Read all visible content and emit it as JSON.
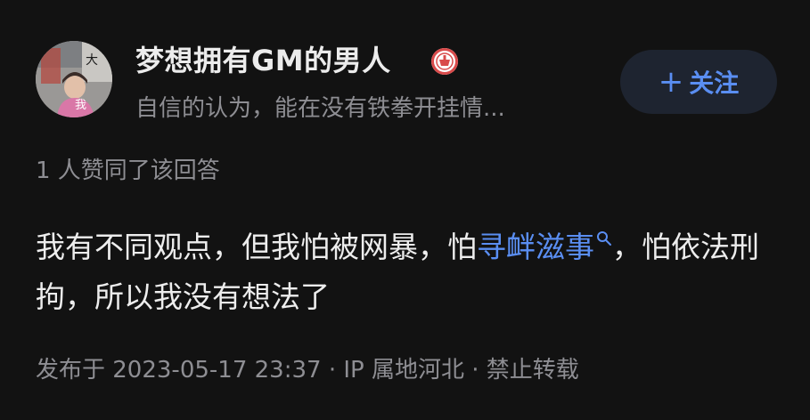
{
  "author": {
    "name": "梦想拥有GM的男人",
    "bio": "自信的认为，能在没有铁拳开挂情...",
    "avatar_text_top": "大",
    "avatar_text_bottom": "我"
  },
  "follow_button": {
    "plus": "+",
    "label": "关注"
  },
  "likes": "1 人赞同了该回答",
  "answer": {
    "part1": "我有不同观点，但我怕被网暴，怕",
    "link_text": "寻衅滋事",
    "part2": "，怕依法刑拘，所以我没有想法了"
  },
  "meta": "发布于 2023-05-17 23:37 · IP 属地河北 · 禁止转载",
  "colors": {
    "background": "#121212",
    "accent": "#5a8ef2",
    "primary_text": "#ececec",
    "secondary_text": "#8e8e93",
    "follow_button_bg": "#1e2430",
    "badge_red": "#d94b4b"
  },
  "icons": {
    "verified": "red-badge-icon",
    "search": "search-icon"
  }
}
